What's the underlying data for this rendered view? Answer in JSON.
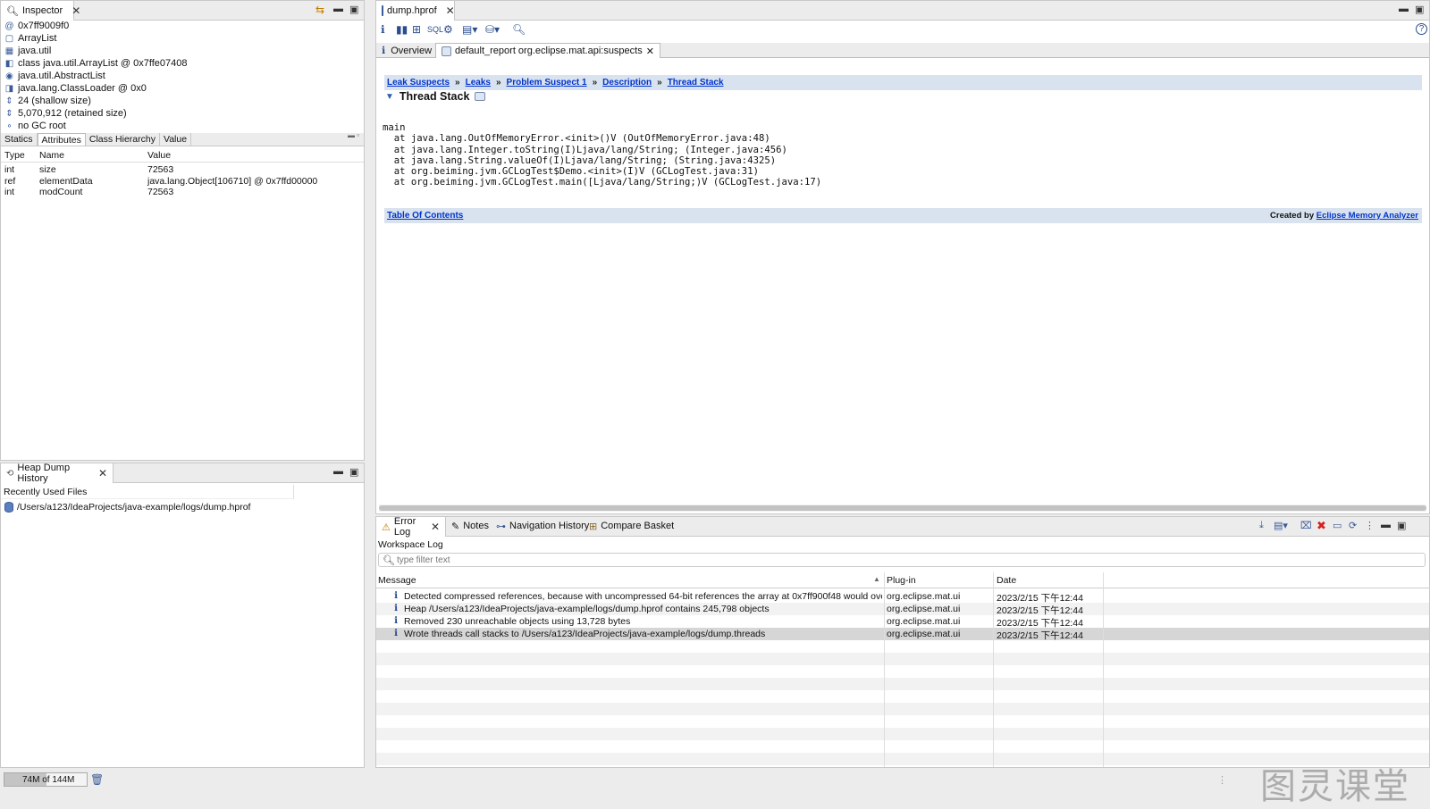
{
  "inspector": {
    "tab_label": "Inspector",
    "tree": [
      {
        "icon": "at-icon",
        "glyph": "@",
        "text": "0x7ff9009f0"
      },
      {
        "icon": "class-icon",
        "glyph": "▢",
        "text": "ArrayList"
      },
      {
        "icon": "package-icon",
        "glyph": "▦",
        "text": "java.util"
      },
      {
        "icon": "class-object-icon",
        "glyph": "◧",
        "text": "class java.util.ArrayList @ 0x7ffe07408"
      },
      {
        "icon": "superclass-icon",
        "glyph": "◉",
        "text": "java.util.AbstractList"
      },
      {
        "icon": "classloader-icon",
        "glyph": "◨",
        "text": "java.lang.ClassLoader @ 0x0"
      },
      {
        "icon": "shallow-size-icon",
        "glyph": "⇕",
        "text": "24 (shallow size)"
      },
      {
        "icon": "retained-size-icon",
        "glyph": "⇕",
        "text": "5,070,912 (retained size)"
      },
      {
        "icon": "gc-root-icon",
        "glyph": "∘",
        "text": "no GC root"
      }
    ],
    "subtabs": [
      "Statics",
      "Attributes",
      "Class Hierarchy",
      "Value"
    ],
    "active_subtab": "Attributes",
    "columns": [
      "Type",
      "Name",
      "Value"
    ],
    "rows": [
      {
        "type": "int",
        "name": "size",
        "value": "72563"
      },
      {
        "type": "ref",
        "name": "elementData",
        "value": "java.lang.Object[106710] @ 0x7ffd00000"
      },
      {
        "type": "int",
        "name": "modCount",
        "value": "72563"
      }
    ]
  },
  "history": {
    "tab_label": "Heap Dump History",
    "header": "Recently Used Files",
    "files": [
      "/Users/a123/IdeaProjects/java-example/logs/dump.hprof"
    ]
  },
  "editor": {
    "tab_label": "dump.hprof",
    "subtabs": [
      {
        "label": "Overview"
      },
      {
        "label": "default_report  org.eclipse.mat.api:suspects"
      }
    ],
    "breadcrumb": [
      "Leak Suspects",
      "Leaks",
      "Problem Suspect 1",
      "Description",
      "Thread Stack"
    ],
    "separator": "»",
    "section_title": "Thread Stack",
    "stack_text": "main\n  at java.lang.OutOfMemoryError.<init>()V (OutOfMemoryError.java:48)\n  at java.lang.Integer.toString(I)Ljava/lang/String; (Integer.java:456)\n  at java.lang.String.valueOf(I)Ljava/lang/String; (String.java:4325)\n  at org.beiming.jvm.GCLogTest$Demo.<init>(I)V (GCLogTest.java:31)\n  at org.beiming.jvm.GCLogTest.main([Ljava/lang/String;)V (GCLogTest.java:17)",
    "footer_link": "Table Of Contents",
    "created_by": "Created by",
    "created_by_link": "Eclipse Memory Analyzer"
  },
  "bottom": {
    "tabs": [
      "Error Log",
      "Notes",
      "Navigation History",
      "Compare Basket"
    ],
    "workspace_label": "Workspace Log",
    "filter_placeholder": "type filter text",
    "columns": [
      "Message",
      "Plug-in",
      "Date"
    ],
    "rows": [
      {
        "message": "Detected compressed references, because with uncompressed 64-bit references the array at 0x7ff900f48 would overlap th",
        "plugin": "org.eclipse.mat.ui",
        "date": "2023/2/15 下午12:44"
      },
      {
        "message": "Heap /Users/a123/IdeaProjects/java-example/logs/dump.hprof contains 245,798 objects",
        "plugin": "org.eclipse.mat.ui",
        "date": "2023/2/15 下午12:44"
      },
      {
        "message": "Removed 230 unreachable objects using 13,728 bytes",
        "plugin": "org.eclipse.mat.ui",
        "date": "2023/2/15 下午12:44"
      },
      {
        "message": "Wrote threads call stacks to /Users/a123/IdeaProjects/java-example/logs/dump.threads",
        "plugin": "org.eclipse.mat.ui",
        "date": "2023/2/15 下午12:44"
      }
    ]
  },
  "status": {
    "heap_text": "74M of 144M",
    "heap_used_fraction": 0.51
  },
  "watermark": "图灵课堂"
}
